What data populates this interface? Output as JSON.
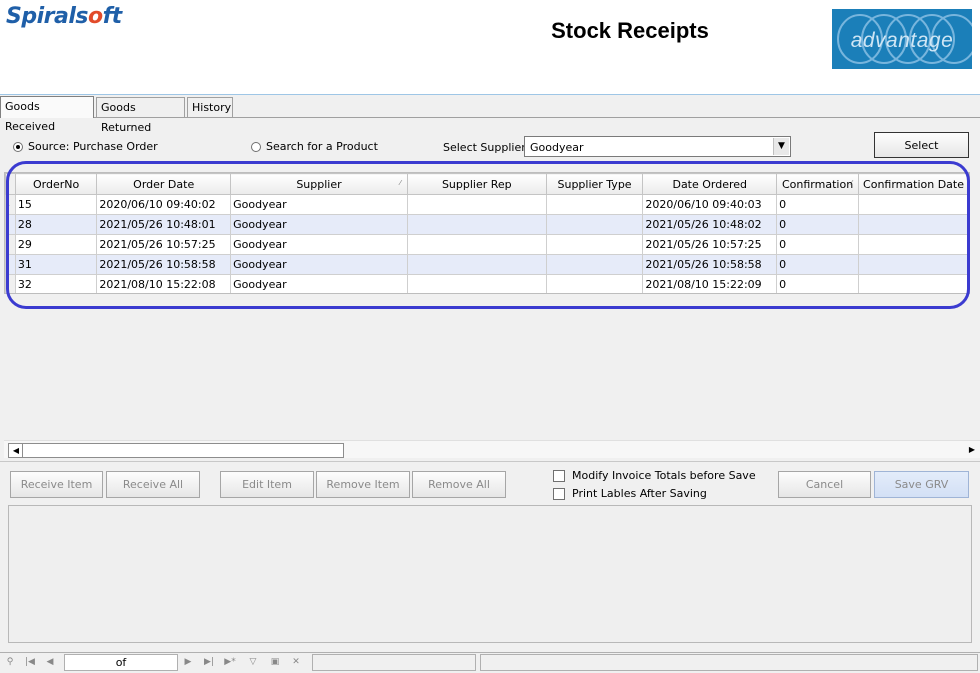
{
  "header": {
    "logo_prefix": "Spirals",
    "logo_o": "o",
    "logo_suffix": "ft",
    "title": "Stock Receipts",
    "brand": "advantage"
  },
  "tabs": [
    {
      "label": "Goods Received",
      "active": true
    },
    {
      "label": "Goods Returned",
      "active": false
    },
    {
      "label": "History",
      "active": false
    }
  ],
  "filter": {
    "source_po_label": "Source: Purchase Order",
    "search_product_label": "Search for a Product",
    "supplier_label": "Select Supplier",
    "supplier_value": "Goodyear",
    "select_button": "Select"
  },
  "grid": {
    "columns": [
      "OrderNo",
      "Order Date",
      "Supplier",
      "Supplier Rep",
      "Supplier Type",
      "Date Ordered",
      "Confirmation",
      "Confirmation Date"
    ],
    "rows": [
      [
        "15",
        "2020/06/10 09:40:02",
        "Goodyear",
        "",
        "",
        "2020/06/10 09:40:03",
        "0",
        ""
      ],
      [
        "28",
        "2021/05/26 10:48:01",
        "Goodyear",
        "",
        "",
        "2021/05/26 10:48:02",
        "0",
        ""
      ],
      [
        "29",
        "2021/05/26 10:57:25",
        "Goodyear",
        "",
        "",
        "2021/05/26 10:57:25",
        "0",
        ""
      ],
      [
        "31",
        "2021/05/26 10:58:58",
        "Goodyear",
        "",
        "",
        "2021/05/26 10:58:58",
        "0",
        ""
      ],
      [
        "32",
        "2021/08/10 15:22:08",
        "Goodyear",
        "",
        "",
        "2021/08/10 15:22:09",
        "0",
        ""
      ]
    ]
  },
  "actions": {
    "receive_item": "Receive Item",
    "receive_all": "Receive All",
    "edit_item": "Edit Item",
    "remove_item": "Remove Item",
    "remove_all": "Remove All",
    "modify_invoice": "Modify Invoice Totals before Save",
    "print_labels": "Print Lables After Saving",
    "cancel": "Cancel",
    "save_grv": "Save GRV"
  },
  "navigator": {
    "position_text": "of"
  },
  "colors": {
    "highlight": "#3b3bd0",
    "alt_row": "#e6ebf9",
    "brand_bg": "#1b7fb9"
  }
}
